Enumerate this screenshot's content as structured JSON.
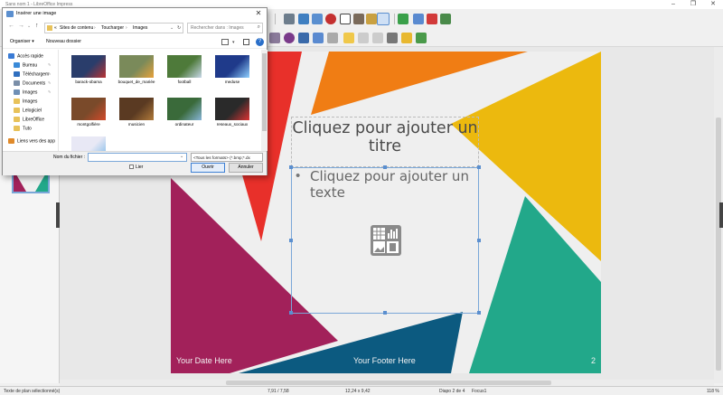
{
  "app": {
    "title": "Sans nom 1 - LibreOffice Impress",
    "window_controls": [
      "–",
      "❐",
      "✕"
    ]
  },
  "slide": {
    "title_placeholder": "Cliquez pour ajouter un titre",
    "title_line1": "Cliquez pour ajouter un",
    "title_line2": "titre",
    "body_line1": "Cliquez pour ajouter un",
    "body_line2": "texte",
    "bullet": "•",
    "footer_date": "Your Date Here",
    "footer_text": "Your Footer Here",
    "slide_number": "2"
  },
  "dialog": {
    "title": "Insérer une image",
    "close": "✕",
    "breadcrumb": [
      "Sites de contenu",
      "Toucharger",
      "Images"
    ],
    "breadcrumb_sep": "›",
    "breadcrumb_prefix": "«",
    "search_placeholder": "Rechercher dans : Images",
    "organize": "Organiser ▾",
    "new_folder": "Nouveau dossier",
    "nav_items": [
      {
        "label": "Accès rapide",
        "color": "#3a7bd5"
      },
      {
        "label": "Bureau",
        "color": "#3a8ad8"
      },
      {
        "label": "Téléchargem",
        "color": "#2f6fbf"
      },
      {
        "label": "Documents",
        "color": "#7a8ea8"
      },
      {
        "label": "Images",
        "color": "#6f8fb5"
      },
      {
        "label": "Images",
        "color": "#e8c25a"
      },
      {
        "label": "Lelogiciel",
        "color": "#e8c25a"
      },
      {
        "label": "LibreOffice",
        "color": "#e8c25a"
      },
      {
        "label": "Tuto",
        "color": "#e8c25a"
      },
      {
        "label": "Liens vers des app",
        "color": "#e08a2a"
      }
    ],
    "files": [
      {
        "label": "barack-obama",
        "color": "#2a3d6b",
        "accent": "#b33"
      },
      {
        "label": "bouquet_de_mariée",
        "color": "#7a8a5a",
        "accent": "#e7a13a"
      },
      {
        "label": "football",
        "color": "#4e7a3a",
        "accent": "#c7d7e8"
      },
      {
        "label": "meduse",
        "color": "#1f3a8a",
        "accent": "#8fd0ff"
      },
      {
        "label": "montgolfière",
        "color": "#7a4a2a",
        "accent": "#d24a2a"
      },
      {
        "label": "musicien",
        "color": "#5a3a22",
        "accent": "#b07a3a"
      },
      {
        "label": "ordinateur",
        "color": "#3a6a3a",
        "accent": "#87b5d8"
      },
      {
        "label": "reseaux_sociaux",
        "color": "#2a2a2a",
        "accent": "#d33"
      },
      {
        "label": "",
        "color": "#e8e8f5",
        "accent": "#7ab8e8"
      }
    ],
    "filename_label": "Nom du fichier :",
    "filename_value": "",
    "filter_value": "<Tous les formats> (*.bmp;*.dx",
    "link_label": "Lier",
    "open_button": "Ouvrir",
    "cancel_button": "Annuler"
  },
  "statusbar": {
    "left": "Texte de plan sélectionné(s)",
    "position": "7,91 / 7,58",
    "size": "12,24 x 9,42",
    "slide_info": "Diapo 2 de 4",
    "master": "Focus1",
    "zoom": "118 %"
  },
  "colors": {
    "red": "#e8302a",
    "orange": "#f07d14",
    "yellow": "#ecb90e",
    "teal": "#22a88a",
    "magenta": "#a2215a",
    "navy": "#0c5a80",
    "selection": "#7aa7d8"
  }
}
